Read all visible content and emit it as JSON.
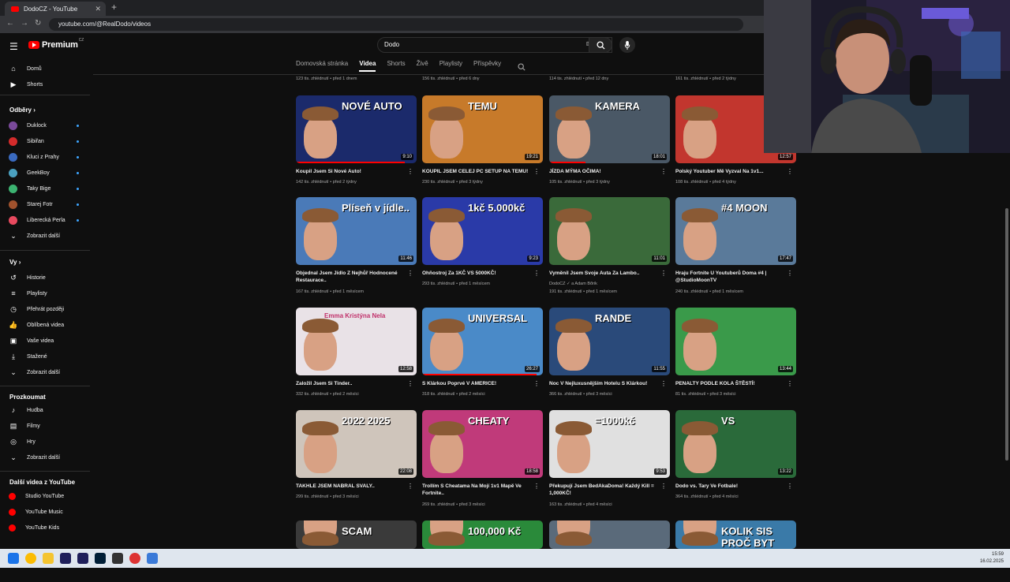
{
  "browser": {
    "tab_title": "DodoCZ - YouTube",
    "tab_close": "✕",
    "new_tab": "+",
    "url": "youtube.com/@RealDodo/videos"
  },
  "header": {
    "logo_text": "Premium",
    "logo_region": "CZ",
    "search_value": "Dodo",
    "search_clear": "✕"
  },
  "sidebar": {
    "main": [
      {
        "label": "Domů",
        "icon": "home-icon"
      },
      {
        "label": "Shorts",
        "icon": "shorts-icon"
      }
    ],
    "subs_heading": "Odběry",
    "subscriptions": [
      {
        "label": "Duklock",
        "color": "#7a4a9a"
      },
      {
        "label": "Sibiřan",
        "color": "#d42b2b"
      },
      {
        "label": "Kluci z Prahy",
        "color": "#3a6ac0"
      },
      {
        "label": "GeekBoy",
        "color": "#4aa0c0"
      },
      {
        "label": "Taky Bige",
        "color": "#3cb371"
      },
      {
        "label": "Starej Fotr",
        "color": "#a0522d"
      },
      {
        "label": "Liberecká Perla",
        "color": "#e84a5f"
      }
    ],
    "show_more": "Zobrazit další",
    "you_heading": "Vy",
    "you_items": [
      {
        "label": "Historie",
        "icon": "history-icon"
      },
      {
        "label": "Playlisty",
        "icon": "playlists-icon"
      },
      {
        "label": "Přehrát později",
        "icon": "watch-later-icon"
      },
      {
        "label": "Oblíbená videa",
        "icon": "liked-icon"
      },
      {
        "label": "Vaše videa",
        "icon": "your-videos-icon"
      },
      {
        "label": "Stažené",
        "icon": "download-icon"
      },
      {
        "label": "Zobrazit další",
        "icon": "chevron-down-icon"
      }
    ],
    "explore_heading": "Prozkoumat",
    "explore_items": [
      {
        "label": "Hudba",
        "icon": "music-icon"
      },
      {
        "label": "Filmy",
        "icon": "film-icon"
      },
      {
        "label": "Hry",
        "icon": "gaming-icon"
      },
      {
        "label": "Zobrazit další",
        "icon": "chevron-down-icon"
      }
    ],
    "more_heading": "Další videa z YouTube",
    "more_items": [
      {
        "label": "Studio YouTube"
      },
      {
        "label": "YouTube Music"
      },
      {
        "label": "YouTube Kids"
      }
    ]
  },
  "channel_tabs": [
    "Domovská stránka",
    "Videa",
    "Shorts",
    "Živě",
    "Playlisty",
    "Příspěvky"
  ],
  "active_tab": "Videa",
  "top_meta": [
    "123 tis. zhlédnutí • před 1 dnem",
    "156 tis. zhlédnutí • před 6 dny",
    "114 tis. zhlédnutí • před 12 dny",
    "161 tis. zhlédnutí • před 2 týdny"
  ],
  "videos": [
    {
      "title": "Koupil Jsem Si Nové Auto!",
      "meta": "142 tis. zhlédnutí • před 2 týdny",
      "duration": "9:10",
      "caption": "NOVÉ AUTO",
      "bg": "#1b2a6b",
      "progress": 0.9
    },
    {
      "title": "KOUPIL JSEM CELEJ PC SETUP NA TEMU!",
      "meta": "230 tis. zhlédnutí • před 3 týdny",
      "duration": "19:21",
      "caption": "TEMU",
      "bg": "#c77a2a",
      "progress": 0
    },
    {
      "title": "JÍZDA MÝMA OČIMA!",
      "meta": "105 tis. zhlédnutí • před 3 týdny",
      "duration": "18:01",
      "caption": "KAMERA",
      "bg": "#4a5866",
      "progress": 0.3
    },
    {
      "title": "Polský Youtuber Mě Vyzval Na 1v1...",
      "meta": "108 tis. zhlédnutí • před 4 týdny",
      "duration": "12:57",
      "caption": "",
      "bg": "#c2362e",
      "progress": 0
    },
    {
      "title": "Objednal Jsem Jídlo Z Nejhůř Hodnocené Restaurace..",
      "meta": "167 tis. zhlédnutí • před 1 měsícem",
      "duration": "11:46",
      "caption": "Plíseň v jídle..",
      "bg": "#4a7ab8",
      "progress": 0
    },
    {
      "title": "Ohňostroj Za 1KČ VS 5000KČ!",
      "meta": "293 tis. zhlédnutí • před 1 měsícem",
      "duration": "9:23",
      "caption": "1kč   5.000kč",
      "bg": "#2a3aa8",
      "progress": 0
    },
    {
      "title": "Vyměnil Jsem Svoje Auta Za Lambo..",
      "meta2": "DodoCZ ✓ a Adam Bőrik",
      "meta": "191 tis. zhlédnutí • před 1 měsícem",
      "duration": "11:01",
      "caption": "",
      "bg": "#3a6a3a",
      "progress": 0
    },
    {
      "title": "Hraju Fortnite U Youtuberů Doma #4 | @StudioMoonTV",
      "meta": "240 tis. zhlédnutí • před 1 měsícem",
      "duration": "17:47",
      "caption": "#4  MOON",
      "bg": "#5a7a9a",
      "progress": 0
    },
    {
      "title": "Založil Jsem Si Tinder..",
      "meta": "332 tis. zhlédnutí • před 2 měsíci",
      "duration": "12:58",
      "caption": "Emma  Kristýna  Nela",
      "bg": "#e9e2e7",
      "progress": 0
    },
    {
      "title": "S Klárkou Poprvé V AMERICE!",
      "meta": "318 tis. zhlédnutí • před 2 měsíci",
      "duration": "26:27",
      "caption": "UNIVERSAL",
      "bg": "#4a8ac8",
      "progress": 0.95
    },
    {
      "title": "Noc V Nejluxusnějším Hotelu S Klárkou!",
      "meta": "366 tis. zhlédnutí • před 3 měsíci",
      "duration": "11:55",
      "caption": "RANDE",
      "bg": "#2a4a7a",
      "progress": 0
    },
    {
      "title": "PENALTY PODLE KOLA ŠTĚSTÍ!",
      "meta": "81 tis. zhlédnutí • před 3 měsíci",
      "duration": "13:44",
      "caption": "",
      "bg": "#3a9a4a",
      "progress": 0
    },
    {
      "title": "TAKHLE JSEM NABRAL SVALY..",
      "meta": "299 tis. zhlédnutí • před 3 měsíci",
      "duration": "22:08",
      "caption": "2022   2025",
      "bg": "#cfc5bb",
      "progress": 0
    },
    {
      "title": "Trollím S Cheatama Na Mojí 1v1 Mapě Ve Fortnite..",
      "meta": "269 tis. zhlédnutí • před 3 měsíci",
      "duration": "18:58",
      "caption": "CHEATY",
      "bg": "#c03a7a",
      "progress": 0
    },
    {
      "title": "Překupují Jsem BedAkaDoma! Každý Kill = 1,000KČ!",
      "meta": "163 tis. zhlédnutí • před 4 měsíci",
      "duration": "9:53",
      "caption": "=1000kč",
      "bg": "#e0e0e0",
      "progress": 0
    },
    {
      "title": "Dodo vs. Tary Ve Fotbale!",
      "meta": "364 tis. zhlédnutí • před 4 měsíci",
      "duration": "13:22",
      "caption": "VS",
      "bg": "#2a6a3a",
      "progress": 0
    },
    {
      "title": "",
      "meta": "",
      "duration": "",
      "caption": "SCAM",
      "bg": "#3a3a3a",
      "progress": 0
    },
    {
      "title": "",
      "meta": "",
      "duration": "",
      "caption": "100,000 Kč",
      "bg": "#2a8a3a",
      "progress": 0
    },
    {
      "title": "",
      "meta": "",
      "duration": "",
      "caption": "",
      "bg": "#5a6a7a",
      "progress": 0
    },
    {
      "title": "",
      "meta": "",
      "duration": "",
      "caption": "KOLIK SIS  PROČ BYT",
      "bg": "#3a7aa8",
      "progress": 0
    }
  ],
  "taskbar": {
    "time": "15:59",
    "date": "16.02.2025"
  }
}
